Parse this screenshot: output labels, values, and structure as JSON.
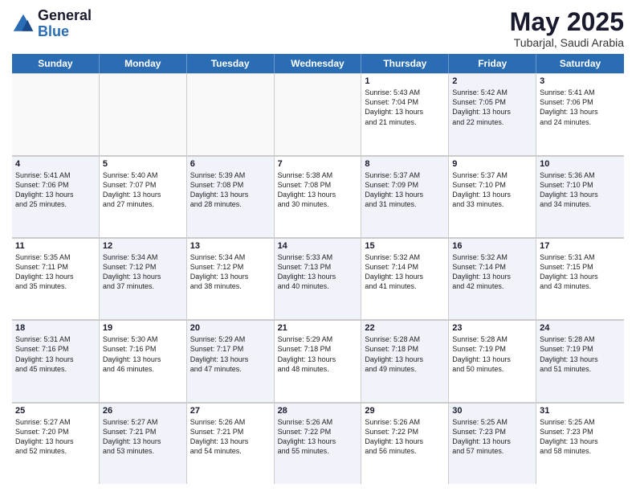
{
  "logo": {
    "general": "General",
    "blue": "Blue"
  },
  "header": {
    "month": "May 2025",
    "location": "Tubarjal, Saudi Arabia"
  },
  "weekdays": [
    "Sunday",
    "Monday",
    "Tuesday",
    "Wednesday",
    "Thursday",
    "Friday",
    "Saturday"
  ],
  "weeks": [
    [
      {
        "day": "",
        "lines": [],
        "empty": true
      },
      {
        "day": "",
        "lines": [],
        "empty": true
      },
      {
        "day": "",
        "lines": [],
        "empty": true
      },
      {
        "day": "",
        "lines": [],
        "empty": true
      },
      {
        "day": "1",
        "lines": [
          "Sunrise: 5:43 AM",
          "Sunset: 7:04 PM",
          "Daylight: 13 hours",
          "and 21 minutes."
        ]
      },
      {
        "day": "2",
        "lines": [
          "Sunrise: 5:42 AM",
          "Sunset: 7:05 PM",
          "Daylight: 13 hours",
          "and 22 minutes."
        ],
        "alt": true
      },
      {
        "day": "3",
        "lines": [
          "Sunrise: 5:41 AM",
          "Sunset: 7:06 PM",
          "Daylight: 13 hours",
          "and 24 minutes."
        ]
      }
    ],
    [
      {
        "day": "4",
        "lines": [
          "Sunrise: 5:41 AM",
          "Sunset: 7:06 PM",
          "Daylight: 13 hours",
          "and 25 minutes."
        ],
        "alt": true
      },
      {
        "day": "5",
        "lines": [
          "Sunrise: 5:40 AM",
          "Sunset: 7:07 PM",
          "Daylight: 13 hours",
          "and 27 minutes."
        ]
      },
      {
        "day": "6",
        "lines": [
          "Sunrise: 5:39 AM",
          "Sunset: 7:08 PM",
          "Daylight: 13 hours",
          "and 28 minutes."
        ],
        "alt": true
      },
      {
        "day": "7",
        "lines": [
          "Sunrise: 5:38 AM",
          "Sunset: 7:08 PM",
          "Daylight: 13 hours",
          "and 30 minutes."
        ]
      },
      {
        "day": "8",
        "lines": [
          "Sunrise: 5:37 AM",
          "Sunset: 7:09 PM",
          "Daylight: 13 hours",
          "and 31 minutes."
        ],
        "alt": true
      },
      {
        "day": "9",
        "lines": [
          "Sunrise: 5:37 AM",
          "Sunset: 7:10 PM",
          "Daylight: 13 hours",
          "and 33 minutes."
        ]
      },
      {
        "day": "10",
        "lines": [
          "Sunrise: 5:36 AM",
          "Sunset: 7:10 PM",
          "Daylight: 13 hours",
          "and 34 minutes."
        ],
        "alt": true
      }
    ],
    [
      {
        "day": "11",
        "lines": [
          "Sunrise: 5:35 AM",
          "Sunset: 7:11 PM",
          "Daylight: 13 hours",
          "and 35 minutes."
        ]
      },
      {
        "day": "12",
        "lines": [
          "Sunrise: 5:34 AM",
          "Sunset: 7:12 PM",
          "Daylight: 13 hours",
          "and 37 minutes."
        ],
        "alt": true
      },
      {
        "day": "13",
        "lines": [
          "Sunrise: 5:34 AM",
          "Sunset: 7:12 PM",
          "Daylight: 13 hours",
          "and 38 minutes."
        ]
      },
      {
        "day": "14",
        "lines": [
          "Sunrise: 5:33 AM",
          "Sunset: 7:13 PM",
          "Daylight: 13 hours",
          "and 40 minutes."
        ],
        "alt": true
      },
      {
        "day": "15",
        "lines": [
          "Sunrise: 5:32 AM",
          "Sunset: 7:14 PM",
          "Daylight: 13 hours",
          "and 41 minutes."
        ]
      },
      {
        "day": "16",
        "lines": [
          "Sunrise: 5:32 AM",
          "Sunset: 7:14 PM",
          "Daylight: 13 hours",
          "and 42 minutes."
        ],
        "alt": true
      },
      {
        "day": "17",
        "lines": [
          "Sunrise: 5:31 AM",
          "Sunset: 7:15 PM",
          "Daylight: 13 hours",
          "and 43 minutes."
        ]
      }
    ],
    [
      {
        "day": "18",
        "lines": [
          "Sunrise: 5:31 AM",
          "Sunset: 7:16 PM",
          "Daylight: 13 hours",
          "and 45 minutes."
        ],
        "alt": true
      },
      {
        "day": "19",
        "lines": [
          "Sunrise: 5:30 AM",
          "Sunset: 7:16 PM",
          "Daylight: 13 hours",
          "and 46 minutes."
        ]
      },
      {
        "day": "20",
        "lines": [
          "Sunrise: 5:29 AM",
          "Sunset: 7:17 PM",
          "Daylight: 13 hours",
          "and 47 minutes."
        ],
        "alt": true
      },
      {
        "day": "21",
        "lines": [
          "Sunrise: 5:29 AM",
          "Sunset: 7:18 PM",
          "Daylight: 13 hours",
          "and 48 minutes."
        ]
      },
      {
        "day": "22",
        "lines": [
          "Sunrise: 5:28 AM",
          "Sunset: 7:18 PM",
          "Daylight: 13 hours",
          "and 49 minutes."
        ],
        "alt": true
      },
      {
        "day": "23",
        "lines": [
          "Sunrise: 5:28 AM",
          "Sunset: 7:19 PM",
          "Daylight: 13 hours",
          "and 50 minutes."
        ]
      },
      {
        "day": "24",
        "lines": [
          "Sunrise: 5:28 AM",
          "Sunset: 7:19 PM",
          "Daylight: 13 hours",
          "and 51 minutes."
        ],
        "alt": true
      }
    ],
    [
      {
        "day": "25",
        "lines": [
          "Sunrise: 5:27 AM",
          "Sunset: 7:20 PM",
          "Daylight: 13 hours",
          "and 52 minutes."
        ]
      },
      {
        "day": "26",
        "lines": [
          "Sunrise: 5:27 AM",
          "Sunset: 7:21 PM",
          "Daylight: 13 hours",
          "and 53 minutes."
        ],
        "alt": true
      },
      {
        "day": "27",
        "lines": [
          "Sunrise: 5:26 AM",
          "Sunset: 7:21 PM",
          "Daylight: 13 hours",
          "and 54 minutes."
        ]
      },
      {
        "day": "28",
        "lines": [
          "Sunrise: 5:26 AM",
          "Sunset: 7:22 PM",
          "Daylight: 13 hours",
          "and 55 minutes."
        ],
        "alt": true
      },
      {
        "day": "29",
        "lines": [
          "Sunrise: 5:26 AM",
          "Sunset: 7:22 PM",
          "Daylight: 13 hours",
          "and 56 minutes."
        ]
      },
      {
        "day": "30",
        "lines": [
          "Sunrise: 5:25 AM",
          "Sunset: 7:23 PM",
          "Daylight: 13 hours",
          "and 57 minutes."
        ],
        "alt": true
      },
      {
        "day": "31",
        "lines": [
          "Sunrise: 5:25 AM",
          "Sunset: 7:23 PM",
          "Daylight: 13 hours",
          "and 58 minutes."
        ]
      }
    ]
  ]
}
